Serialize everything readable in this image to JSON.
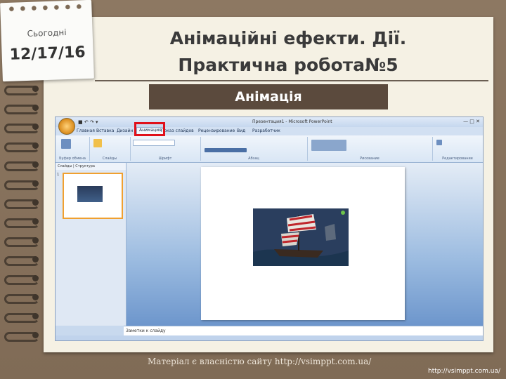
{
  "date_note": {
    "label": "Сьогодні",
    "date": "12/17/16"
  },
  "title": {
    "line1": "Анімаційні ефекти. Дії.",
    "line2": "Практична робота№5"
  },
  "subheading": "Анімація",
  "footer": "Матеріал є власністю сайту http://vsimppt.com.ua/",
  "url": "http://vsimppt.com.ua/",
  "screenshot": {
    "window_title": "Презентация1 - Microsoft PowerPoint",
    "tabs": [
      "Главная",
      "Вставка",
      "Дизайн",
      "Анимация",
      "Показ слайдов",
      "Рецензирование",
      "Вид",
      "Разработчик"
    ],
    "active_tab": "Анимация",
    "groups": [
      "Буфер обмена",
      "Слайды",
      "Шрифт",
      "Абзац",
      "Рисование",
      "Редактирование"
    ],
    "panel_tabs": [
      "Слайды",
      "Структура"
    ],
    "thumb_number": "1",
    "notes_placeholder": "Заметки к слайду",
    "highlight_color": "#e0101a"
  }
}
